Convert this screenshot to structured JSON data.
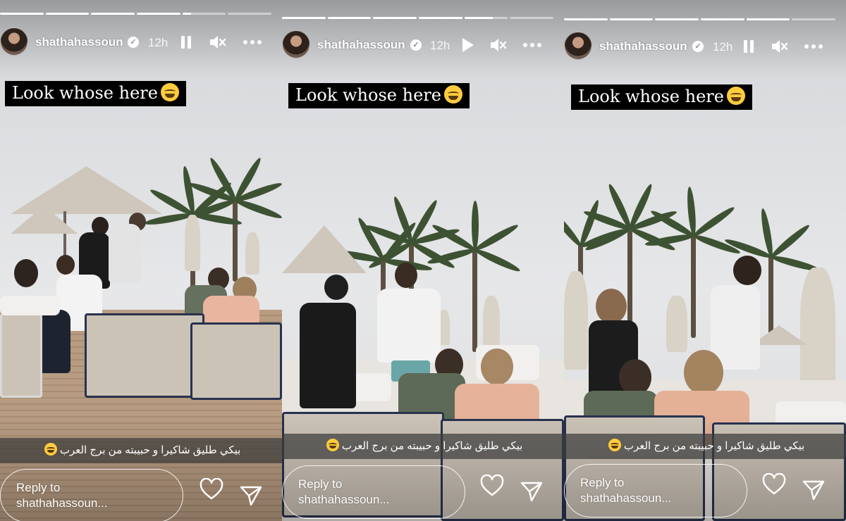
{
  "stories": [
    {
      "username": "shathahassoun",
      "time": "12h",
      "playback_state": "playing",
      "playback_icon": "pause-icon",
      "sound_icon": "muted-icon",
      "more_icon": "more-icon",
      "progress": [
        1,
        1,
        1,
        1,
        0.2,
        0
      ],
      "caption": "Look whose here",
      "caption_emoji": "grimacing-sweat-emoji",
      "arabic_text": "بيكي طليق شاكيرا و حبيبته من برج العرب",
      "reply_label": "Reply to",
      "reply_user": "shathahassoun..."
    },
    {
      "username": "shathahassoun",
      "time": "12h",
      "playback_state": "paused",
      "playback_icon": "play-icon",
      "sound_icon": "muted-icon",
      "more_icon": "more-icon",
      "progress": [
        1,
        1,
        1,
        1,
        0.65,
        0
      ],
      "caption": "Look whose here",
      "caption_emoji": "grimacing-sweat-emoji",
      "arabic_text": "بيكي طليق شاكيرا و حبيبته من برج العرب",
      "reply_label": "Reply to",
      "reply_user": "shathahassoun..."
    },
    {
      "username": "shathahassoun",
      "time": "12h",
      "playback_state": "playing",
      "playback_icon": "pause-icon",
      "sound_icon": "muted-icon",
      "more_icon": "more-icon",
      "progress": [
        1,
        1,
        1,
        1,
        1,
        0
      ],
      "caption": "Look whose here",
      "caption_emoji": "grimacing-sweat-emoji",
      "arabic_text": "بيكي طليق شاكيرا و حبيبته من برج العرب",
      "reply_label": "Reply to",
      "reply_user": "shathahassoun..."
    }
  ],
  "colors": {
    "overlay_text": "#ffffff",
    "caption_bg": "#000000",
    "subtitle_bg": "#3c3c3c"
  }
}
